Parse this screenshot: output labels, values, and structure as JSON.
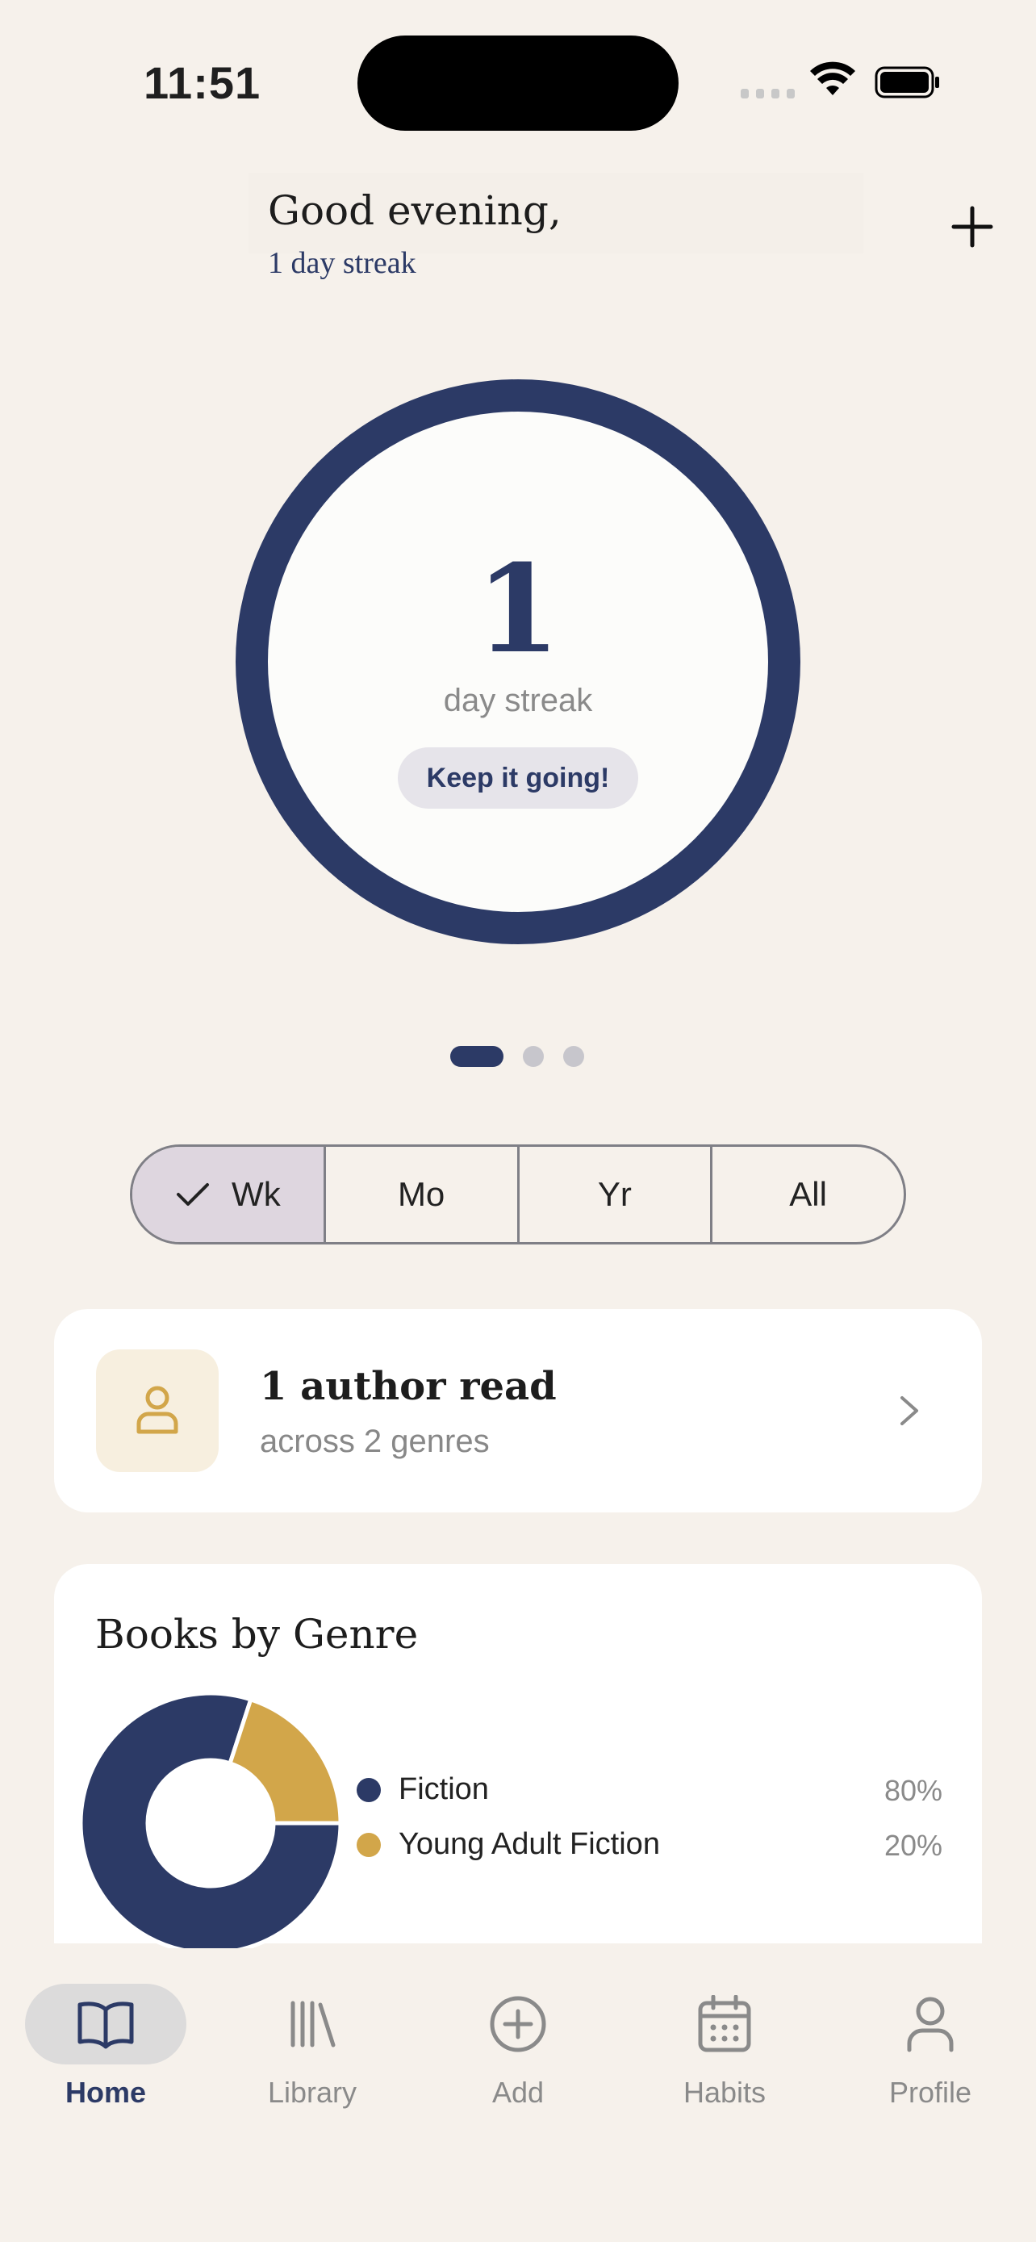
{
  "status_bar": {
    "time": "11:51"
  },
  "header": {
    "greeting": "Good evening,",
    "streak_subtitle": "1 day streak",
    "add_icon": "plus-icon"
  },
  "streak_ring": {
    "number": "1",
    "label": "day streak",
    "cta": "Keep it going!",
    "progress": 1.0,
    "ring_color": "#2c3a66"
  },
  "pager": {
    "count": 3,
    "active_index": 0
  },
  "segmented": {
    "items": [
      "Wk",
      "Mo",
      "Yr",
      "All"
    ],
    "selected": "Wk"
  },
  "author_card": {
    "title": "1 author read",
    "subtitle": "across 2 genres",
    "icon": "person-icon"
  },
  "genre_card": {
    "title": "Books by Genre",
    "legend": [
      {
        "label": "Fiction",
        "percent": "80%",
        "color": "#2c3a66"
      },
      {
        "label": "Young Adult Fiction",
        "percent": "20%",
        "color": "#d2a64a"
      }
    ]
  },
  "chart_data": {
    "type": "pie",
    "title": "Books by Genre",
    "categories": [
      "Fiction",
      "Young Adult Fiction"
    ],
    "values": [
      80,
      20
    ],
    "colors": [
      "#2c3a66",
      "#d2a64a"
    ],
    "donut": true,
    "legend_position": "right"
  },
  "tab_bar": {
    "items": [
      {
        "label": "Home",
        "icon": "book-open-icon",
        "active": true
      },
      {
        "label": "Library",
        "icon": "library-icon",
        "active": false
      },
      {
        "label": "Add",
        "icon": "plus-circle-icon",
        "active": false
      },
      {
        "label": "Habits",
        "icon": "calendar-icon",
        "active": false
      },
      {
        "label": "Profile",
        "icon": "person-icon",
        "active": false
      }
    ]
  }
}
